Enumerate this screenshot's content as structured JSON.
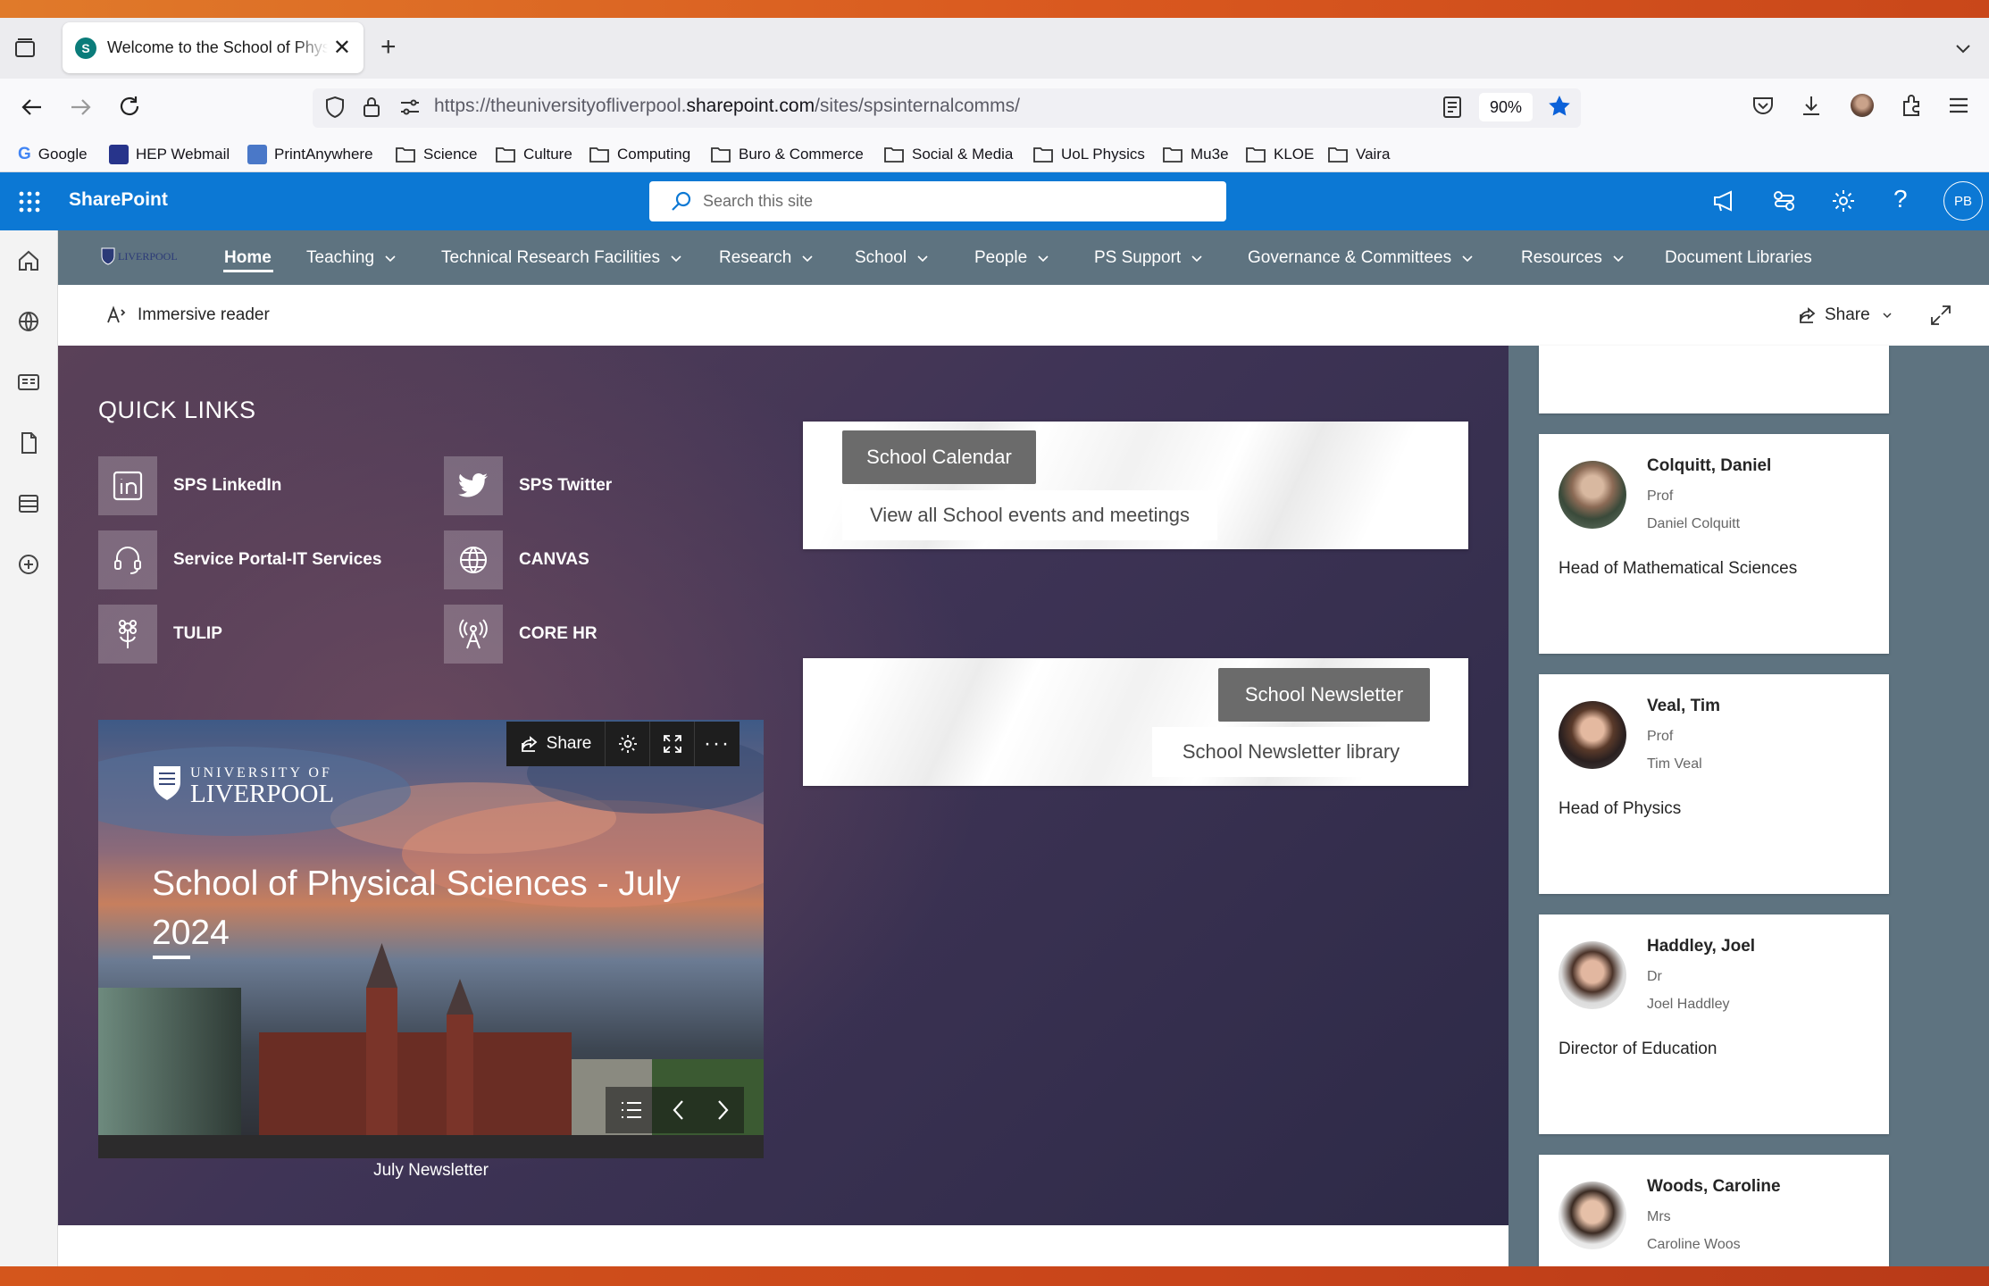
{
  "browser": {
    "tab_title": "Welcome to the School of Physical Sciences",
    "url_prefix": "https://theuniversityofliverpool.",
    "url_domain": "sharepoint.com",
    "url_path": "/sites/spsinternalcomms/",
    "zoom": "90%",
    "bookmarks": [
      "Google",
      "HEP Webmail",
      "PrintAnywhere",
      "Science",
      "Culture",
      "Computing",
      "Buro & Commerce",
      "Social & Media",
      "UoL Physics",
      "Mu3e",
      "KLOE",
      "Vaira"
    ]
  },
  "sharepoint": {
    "app_name": "SharePoint",
    "search_placeholder": "Search this site",
    "user_initials": "PB"
  },
  "hub_nav": {
    "logo_text": "LIVERPOOL",
    "items": [
      "Home",
      "Teaching",
      "Technical Research Facilities",
      "Research",
      "School",
      "People",
      "PS Support",
      "Governance & Committees",
      "Resources",
      "Document Libraries"
    ]
  },
  "command_bar": {
    "immersive_reader": "Immersive reader",
    "share": "Share"
  },
  "quick_links": {
    "title": "QUICK LINKS",
    "items": [
      {
        "label": "SPS LinkedIn",
        "icon": "linkedin-icon"
      },
      {
        "label": "SPS Twitter",
        "icon": "twitter-icon"
      },
      {
        "label": "Service Portal-IT Services",
        "icon": "headset-icon"
      },
      {
        "label": "CANVAS",
        "icon": "globe-icon"
      },
      {
        "label": "TULIP",
        "icon": "flower-icon"
      },
      {
        "label": "CORE HR",
        "icon": "antenna-icon"
      }
    ]
  },
  "calendar_card": {
    "title": "School Calendar",
    "link": "View all School events and meetings"
  },
  "newsletter_card": {
    "title": "School Newsletter",
    "link": "School Newsletter library"
  },
  "news": {
    "logo_top": "UNIVERSITY OF",
    "logo_bottom": "LIVERPOOL",
    "title": "School of Physical Sciences - July 2024",
    "share": "Share",
    "caption": "July Newsletter"
  },
  "people": [
    {
      "name": "Colquitt, Daniel",
      "title": "Prof",
      "full_name": "Daniel Colquitt",
      "role": "Head of Mathematical Sciences"
    },
    {
      "name": "Veal, Tim",
      "title": "Prof",
      "full_name": "Tim Veal",
      "role": "Head of Physics"
    },
    {
      "name": "Haddley, Joel",
      "title": "Dr",
      "full_name": "Joel Haddley",
      "role": "Director of Education"
    },
    {
      "name": "Woods, Caroline",
      "title": "Mrs",
      "full_name": "Caroline Woos",
      "role": ""
    }
  ],
  "colors": {
    "sharepoint_blue": "#0c78d4",
    "hub_nav": "#5e7380",
    "hero_dark": "#3f3456",
    "button_gray": "#6b6b6b"
  }
}
